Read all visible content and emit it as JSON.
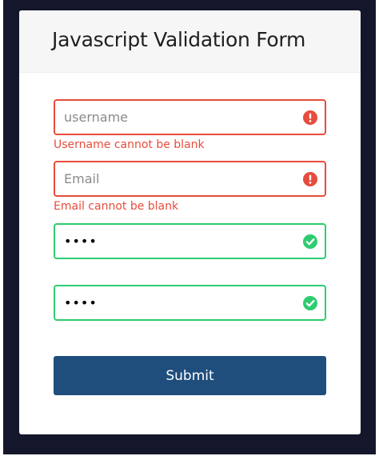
{
  "form": {
    "title": "Javascript Validation Form",
    "username": {
      "placeholder": "username",
      "value": "",
      "state": "error",
      "error": "Username cannot be blank"
    },
    "email": {
      "placeholder": "Email",
      "value": "",
      "state": "error",
      "error": "Email cannot be blank"
    },
    "password": {
      "value": "••••",
      "state": "success"
    },
    "password_confirm": {
      "value": "••••",
      "state": "success"
    },
    "submit_label": "Submit"
  },
  "colors": {
    "error": "#e74c3c",
    "success": "#2ecc71",
    "button": "#1f4e7d",
    "frame": "#14162b"
  },
  "icons": {
    "error": "exclamation-circle-icon",
    "success": "check-circle-icon"
  }
}
